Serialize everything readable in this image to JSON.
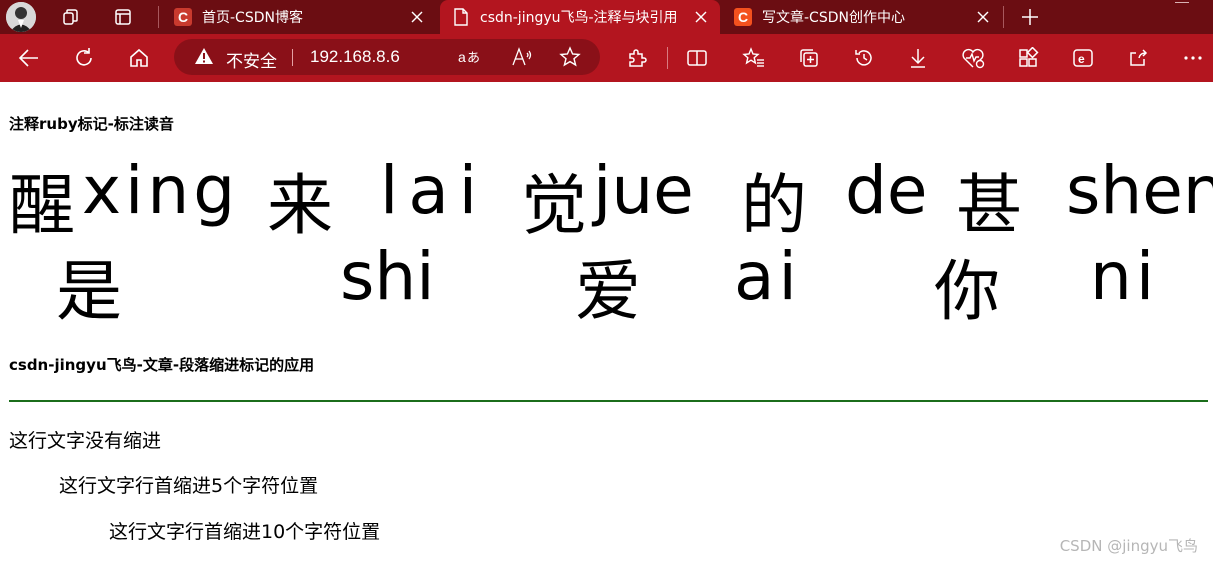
{
  "tabs": [
    {
      "title": "首页-CSDN博客",
      "favicon": "C",
      "favicon_color": "#c93a2e",
      "active": false
    },
    {
      "title": "csdn-jingyu飞鸟-注释与块引用",
      "favicon": "page",
      "active": true
    },
    {
      "title": "写文章-CSDN创作中心",
      "favicon": "C",
      "favicon_color": "#f4511e",
      "active": false
    }
  ],
  "address": {
    "insecure_label": "不安全",
    "url": "192.168.8.6"
  },
  "page": {
    "heading1": "注释ruby标记-标注读音",
    "ruby_line1": [
      {
        "char": "醒",
        "rt": "xing"
      },
      {
        "char": "来",
        "rt": "lai"
      },
      {
        "char": "觉",
        "rt": "jue"
      },
      {
        "char": "的",
        "rt": "de"
      },
      {
        "char": "甚",
        "rt": "shen"
      }
    ],
    "ruby_line2": [
      {
        "char": "是",
        "rt": "shi"
      },
      {
        "char": "爱",
        "rt": "ai"
      },
      {
        "char": "你",
        "rt": "ni"
      }
    ],
    "heading2": "csdn-jingyu飞鸟-文章-段落缩进标记的应用",
    "paragraphs": [
      "这行文字没有缩进",
      "这行文字行首缩进5个字符位置",
      "这行文字行首缩进10个字符位置"
    ],
    "watermark": "CSDN @jingyu飞鸟"
  },
  "colors": {
    "titlebar": "#6b0d12",
    "navbar": "#b3151f",
    "address_bg": "#8a1018",
    "rule": "#1b6d1b"
  }
}
